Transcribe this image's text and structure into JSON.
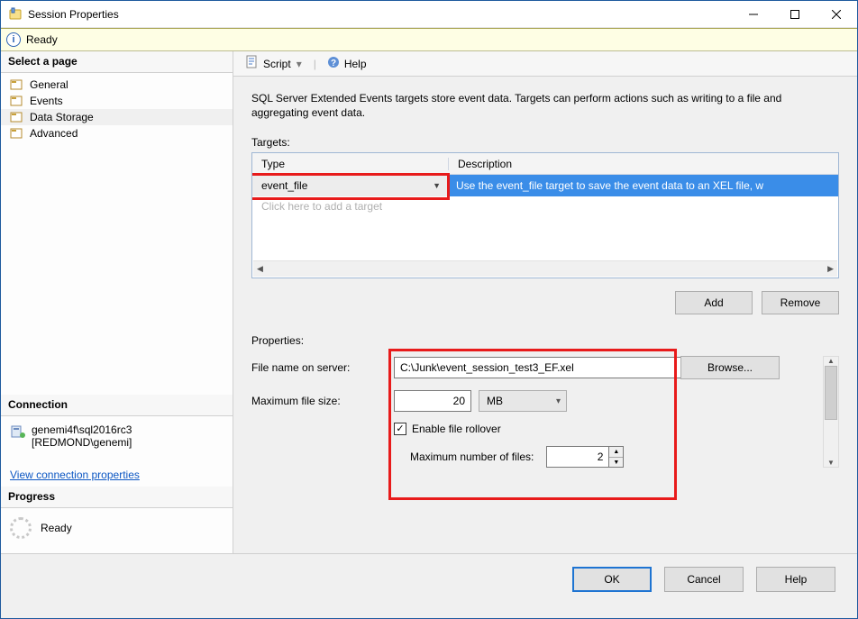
{
  "window": {
    "title": "Session Properties"
  },
  "ready_strip": {
    "text": "Ready"
  },
  "toolbar": {
    "script": "Script",
    "help": "Help"
  },
  "sidebar": {
    "select_page": "Select a page",
    "pages": [
      {
        "label": "General"
      },
      {
        "label": "Events"
      },
      {
        "label": "Data Storage"
      },
      {
        "label": "Advanced"
      }
    ],
    "connection_hdr": "Connection",
    "server": "genemi4f\\sql2016rc3",
    "user": "[REDMOND\\genemi]",
    "view_conn": "View connection properties",
    "progress_hdr": "Progress",
    "progress_text": "Ready"
  },
  "main": {
    "description": "SQL Server Extended Events targets store event data. Targets can perform actions such as writing to a file and aggregating event data.",
    "targets_label": "Targets:",
    "grid": {
      "col_type": "Type",
      "col_desc": "Description",
      "row_type": "event_file",
      "row_desc": "Use the event_file target to save the event data to an XEL file, w",
      "placeholder": "Click here to add a target"
    },
    "buttons": {
      "add": "Add",
      "remove": "Remove"
    },
    "properties_label": "Properties:",
    "form": {
      "file_label": "File name on server:",
      "file_value": "C:\\Junk\\event_session_test3_EF.xel",
      "browse": "Browse...",
      "maxsize_label": "Maximum file size:",
      "maxsize_value": "20",
      "maxsize_unit": "MB",
      "rollover_label": "Enable file rollover",
      "maxfiles_label": "Maximum number of files:",
      "maxfiles_value": "2"
    }
  },
  "footer": {
    "ok": "OK",
    "cancel": "Cancel",
    "help": "Help"
  }
}
